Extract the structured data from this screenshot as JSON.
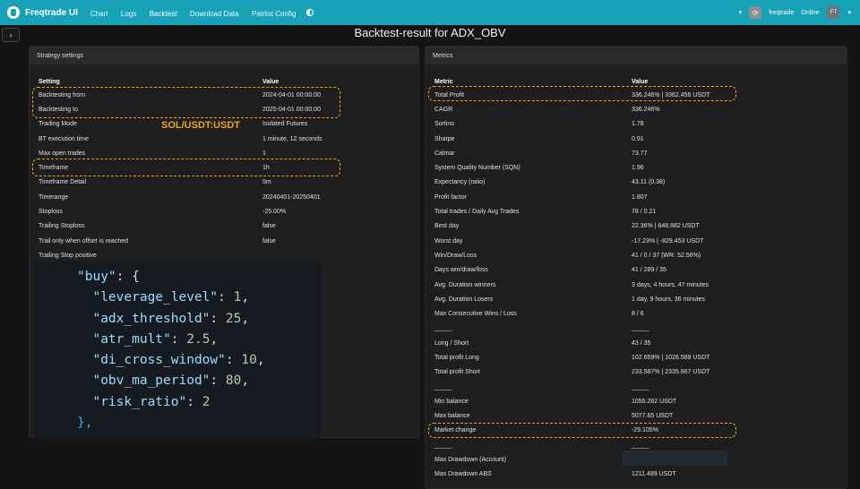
{
  "nav": {
    "brand": "Freqtrade UI",
    "links": [
      "Chart",
      "Logs",
      "Backtest",
      "Download Data",
      "Pairlist Config"
    ],
    "user": "freqtrade",
    "status": "Online",
    "avatar": "FT"
  },
  "page_title": "Backtest-result for ADX_OBV",
  "left_panel": {
    "title": "Strategy settings",
    "headers": [
      "Setting",
      "Value"
    ],
    "rows": [
      [
        "Backtesting from",
        "2024-04-01 00:00:00"
      ],
      [
        "Backtesting to",
        "2025-04-01 00:00:00"
      ],
      [
        "Trading Mode",
        "Isolated Futures"
      ],
      [
        "BT execution time",
        "1 minute, 12 seconds"
      ],
      [
        "Max open trades",
        "1"
      ],
      [
        "Timeframe",
        "1h"
      ],
      [
        "Timeframe Detail",
        "5m"
      ],
      [
        "Timerange",
        "20240401-20250401"
      ],
      [
        "Stoploss",
        "-25.00%"
      ],
      [
        "Trailing Stoploss",
        "false"
      ],
      [
        "Trail only when offset is reached",
        "false"
      ],
      [
        "Trailing Stop positive",
        ""
      ]
    ],
    "overlay_symbol": "SOL/USDT:USDT"
  },
  "code": {
    "l1_key": "\"buy\"",
    "l1_rest": ": {",
    "l2_key": "\"leverage_level\"",
    "l2_val": "1",
    "l3_key": "\"adx_threshold\"",
    "l3_val": "25",
    "l4_key": "\"atr_mult\"",
    "l4_val": "2.5",
    "l5_key": "\"di_cross_window\"",
    "l5_val": "10",
    "l6_key": "\"obv_ma_period\"",
    "l6_val": "80",
    "l7_key": "\"risk_ratio\"",
    "l7_val": "2",
    "l8": "},"
  },
  "right_panel": {
    "title": "Metrics",
    "headers": [
      "Metric",
      "Value"
    ],
    "rows": [
      [
        "Total Profit",
        "336.246% | 3362.456 USDT"
      ],
      [
        "CAGR",
        "336.246%"
      ],
      [
        "Sortino",
        "1.78"
      ],
      [
        "Sharpe",
        "0.91"
      ],
      [
        "Calmar",
        "73.77"
      ],
      [
        "System Quality Number (SQN)",
        "1.96"
      ],
      [
        "Expectancy (ratio)",
        "43.11 (0.38)"
      ],
      [
        "Profit factor",
        "1.807"
      ],
      [
        "Total trades / Daily Avg Trades",
        "78 / 0.21"
      ],
      [
        "Best day",
        "22.36% | 648.882 USDT"
      ],
      [
        "Worst day",
        "-17.23% | -829.453 USDT"
      ],
      [
        "Win/Draw/Loss",
        "41 / 0 / 37 (WR: 52.56%)"
      ],
      [
        "Days win/draw/loss",
        "41 / 289 / 35"
      ],
      [
        "Avg. Duration winners",
        "3 days, 4 hours, 47 minutes"
      ],
      [
        "Avg. Duration Losers",
        "1 day, 9 hours, 36 minutes"
      ],
      [
        "Max Consecutive Wins / Loss",
        "8 / 6"
      ],
      [
        "_____",
        "_____"
      ],
      [
        "Long / Short",
        "43 / 35"
      ],
      [
        "Total profit Long",
        "102.659% | 1026.589 USDT"
      ],
      [
        "Total profit Short",
        "233.587% | 2335.867 USDT"
      ],
      [
        "_____",
        "_____"
      ],
      [
        "Min balance",
        "1055.262 USDT"
      ],
      [
        "Max balance",
        "5077.65 USDT"
      ],
      [
        "Market change",
        "-29.105%"
      ],
      [
        "_____",
        "_____"
      ],
      [
        "Max Drawdown (Account)",
        ""
      ],
      [
        "Max Drawdown ABS",
        "1211.489 USDT"
      ]
    ]
  },
  "colors": {
    "navbar": "#17a2b8",
    "highlight": "#e6a51e"
  }
}
